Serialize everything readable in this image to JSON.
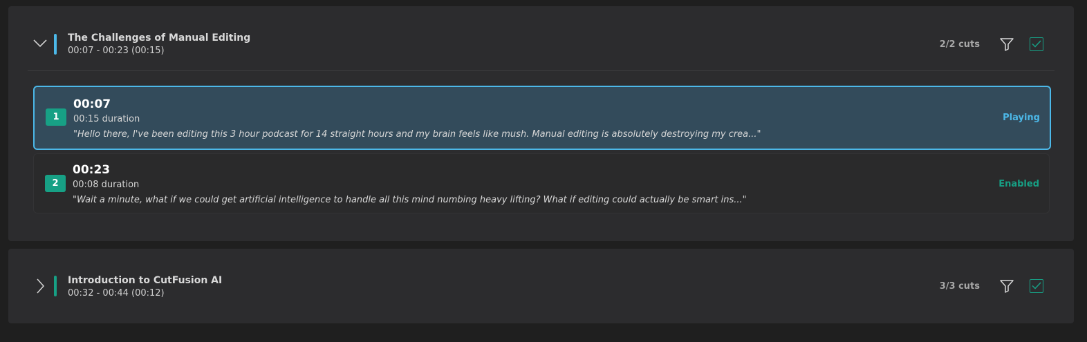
{
  "sections": [
    {
      "expanded": true,
      "title": "The Challenges of Manual Editing",
      "range": "00:07 - 00:23 (00:15)",
      "cuts_label": "2/2 cuts",
      "accent_color": "#4cb8e8",
      "chevron_icon": "chevron-down-icon",
      "filter_icon": "filter-icon",
      "checked": true,
      "cuts": [
        {
          "number": "1",
          "time": "00:07",
          "duration": "00:15 duration",
          "quote": "\"Hello there, I've been editing this 3 hour podcast for 14 straight hours and my brain feels like mush. Manual editing is absolutely destroying my crea...\"",
          "status": "Playing",
          "status_color": "#4cb8e8"
        },
        {
          "number": "2",
          "time": "00:23",
          "duration": "00:08 duration",
          "quote": "\"Wait a minute, what if we could get artificial intelligence to handle all this mind numbing heavy lifting? What if editing could actually be smart ins...\"",
          "status": "Enabled",
          "status_color": "#17a085"
        }
      ]
    },
    {
      "expanded": false,
      "title": "Introduction to CutFusion AI",
      "range": "00:32 - 00:44 (00:12)",
      "cuts_label": "3/3 cuts",
      "accent_color": "#17a085",
      "chevron_icon": "chevron-right-icon",
      "filter_icon": "filter-icon",
      "checked": true
    }
  ],
  "colors": {
    "background": "#1f1f1f",
    "panel": "#2c2c2e",
    "selected_cut": "#334b5b",
    "teal": "#17a085",
    "blue": "#4cb8e8"
  }
}
